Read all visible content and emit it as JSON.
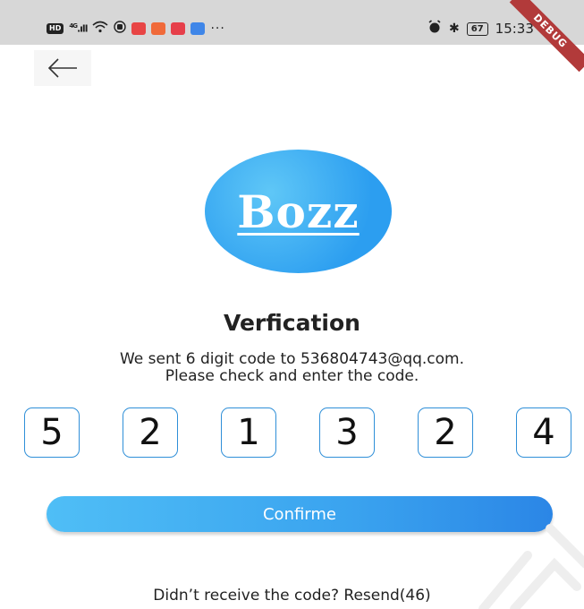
{
  "status_bar": {
    "network": "4G",
    "battery": "67",
    "time": "15:33",
    "more": "···"
  },
  "debug_banner": "DEBUG",
  "logo": {
    "text": "Bozz"
  },
  "title": "Verfication",
  "subtitle_line1": "We sent 6 digit code to 536804743@qq.com.",
  "subtitle_line2": "Please check and enter the code.",
  "code_digits": [
    "5",
    "2",
    "1",
    "3",
    "2",
    "4"
  ],
  "confirm_label": "Confirme",
  "resend_text": "Didn’t receive the code? Resend(46)",
  "colors": {
    "accent": "#3aa3ef",
    "box_border": "#2f8fd8",
    "debug": "#b23a3a"
  }
}
